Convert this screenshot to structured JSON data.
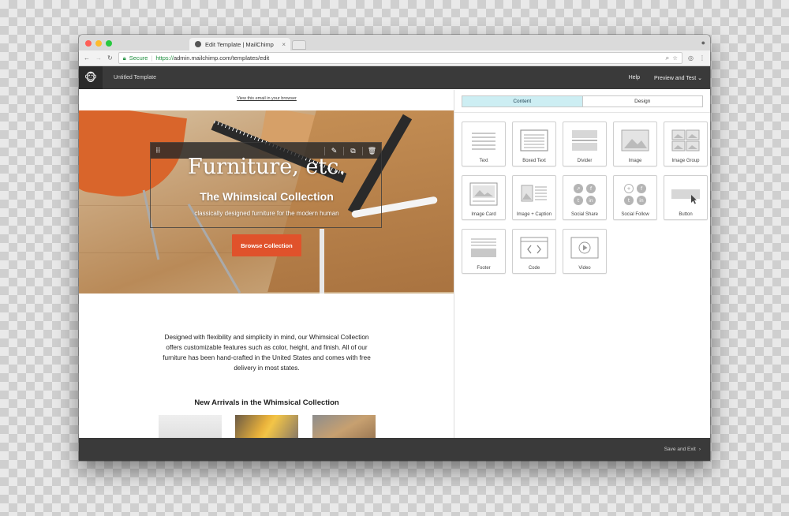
{
  "browser": {
    "tab_title": "Edit Template | MailChimp",
    "tab_close": "×",
    "url_secure_label": "Secure",
    "url_scheme": "https://",
    "url_rest": "admin.mailchimp.com/templates/edit",
    "traffic_colors": [
      "#ff5f57",
      "#febc2e",
      "#28c840"
    ]
  },
  "appbar": {
    "template_name": "Untitled Template",
    "help": "Help",
    "preview": "Preview and Test"
  },
  "email": {
    "view_in_browser": "View this email in your browser",
    "hero_title": "Furniture, etc.",
    "hero_subtitle": "The Whimsical Collection",
    "hero_tagline": "classically designed furniture for the modern human",
    "cta": "Browse Collection",
    "body": "Designed with flexibility and simplicity in mind, our Whimsical Collection offers customizable features such as color, height, and finish. All of our furniture has been hand-crafted in the United States and comes with free delivery in most states.",
    "arrivals_heading": "New Arrivals in the Whimsical Collection"
  },
  "sidebar": {
    "tabs": [
      "Content",
      "Design"
    ],
    "blocks": [
      {
        "label": "Text",
        "icon": "text-block-icon"
      },
      {
        "label": "Boxed Text",
        "icon": "boxed-text-icon"
      },
      {
        "label": "Divider",
        "icon": "divider-icon"
      },
      {
        "label": "Image",
        "icon": "image-icon"
      },
      {
        "label": "Image Group",
        "icon": "image-group-icon"
      },
      {
        "label": "Image Card",
        "icon": "image-card-icon"
      },
      {
        "label": "Image + Caption",
        "icon": "image-caption-icon"
      },
      {
        "label": "Social Share",
        "icon": "social-share-icon"
      },
      {
        "label": "Social Follow",
        "icon": "social-follow-icon"
      },
      {
        "label": "Button",
        "icon": "button-block-icon"
      },
      {
        "label": "Footer",
        "icon": "footer-block-icon"
      },
      {
        "label": "Code",
        "icon": "code-block-icon"
      },
      {
        "label": "Video",
        "icon": "video-block-icon"
      }
    ]
  },
  "footer": {
    "save_exit": "Save and Exit"
  },
  "colors": {
    "cta": "#e0522b",
    "active_tab": "#cdeef3",
    "appbar": "#3a3a3a"
  }
}
